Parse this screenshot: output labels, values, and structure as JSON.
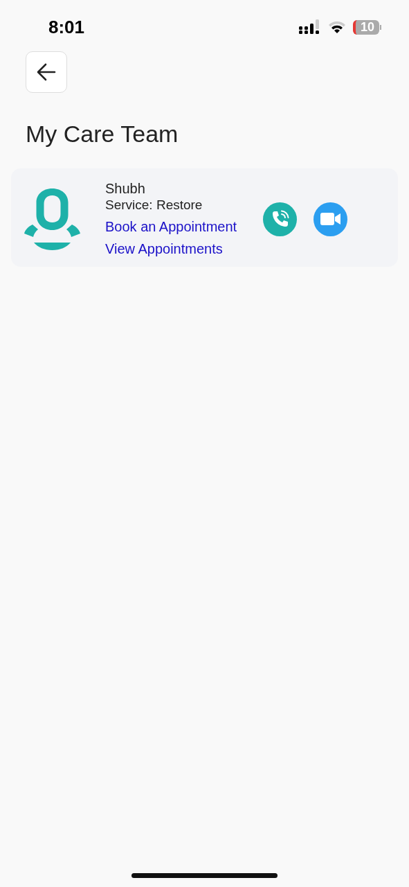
{
  "status_bar": {
    "time": "8:01",
    "battery": "10"
  },
  "header": {
    "title": "My Care Team"
  },
  "care_team": [
    {
      "name": "Shubh",
      "service": "Service: Restore",
      "links": [
        "Book an Appointment",
        "View Appointments"
      ],
      "actions": [
        {
          "kind": "call"
        },
        {
          "kind": "video"
        }
      ]
    }
  ]
}
